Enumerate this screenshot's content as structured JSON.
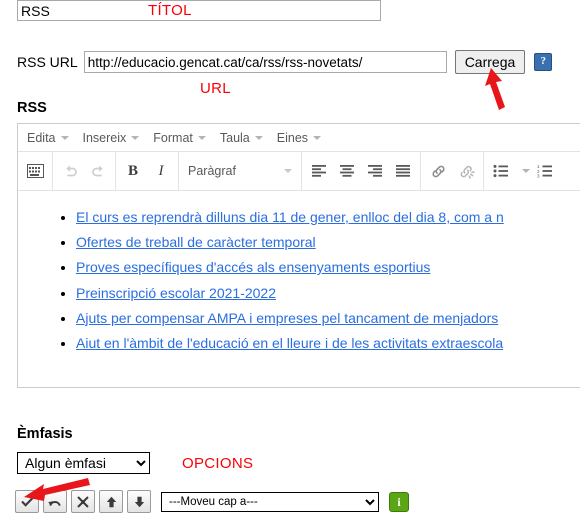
{
  "title_field": {
    "value": "RSS",
    "placeholder": "Títol"
  },
  "annotations": {
    "titol": "TÍTOL",
    "url": "URL",
    "opcions": "OPCIONS"
  },
  "url_row": {
    "label": "RSS URL",
    "value": "http://educacio.gencat.cat/ca/rss/rss-novetats/",
    "placeholder": "http://",
    "load_button": "Carrega",
    "help_icon": "question-mark-icon",
    "help_glyph": "?"
  },
  "section": {
    "rss_heading": "RSS",
    "emfasis_heading": "Èmfasis"
  },
  "editor": {
    "menubar": [
      {
        "label": "Edita"
      },
      {
        "label": "Insereix"
      },
      {
        "label": "Format"
      },
      {
        "label": "Taula"
      },
      {
        "label": "Eines"
      }
    ],
    "toolbar": {
      "special_char": "keyboard-icon",
      "undo": "undo-arrow-icon",
      "redo": "redo-arrow-icon",
      "bold": "B",
      "italic": "I",
      "format_value": "Paràgraf",
      "align_left": "align-left-icon",
      "align_center": "align-center-icon",
      "align_right": "align-right-icon",
      "align_justify": "align-justify-icon",
      "link": "link-icon",
      "unlink": "unlink-icon",
      "bullet_list": "bullet-list-icon",
      "numbered_list": "numbered-list-icon"
    },
    "content_links": [
      "El curs es reprendrà dilluns dia 11 de gener, enlloc del dia 8, com a n",
      "Ofertes de treball de caràcter temporal",
      "Proves específiques d'accés als ensenyaments esportius",
      "Preinscripció escolar 2021-2022",
      "Ajuts per compensar AMPA i empreses pel tancament de menjadors",
      "Aiut en l'àmbit de l'educació en el lleure i de les activitats extraescola"
    ]
  },
  "emfasis": {
    "selected": "Algun èmfasi"
  },
  "action_bar": {
    "buttons": [
      {
        "name": "confirm-check-button",
        "glyph": "✔"
      },
      {
        "name": "undo-button",
        "glyph": "↶"
      },
      {
        "name": "delete-button",
        "glyph": "✖"
      },
      {
        "name": "move-up-button",
        "glyph": "▲"
      },
      {
        "name": "move-down-button",
        "glyph": "▼"
      }
    ],
    "move_select": "---Moveu cap a---",
    "info_icon": "info-icon",
    "info_glyph": "i"
  },
  "colors": {
    "annotation_red": "#fb0007",
    "link_blue": "#2a6ee0",
    "help_blue": "#3a6fb0",
    "info_green": "#5aa615"
  }
}
